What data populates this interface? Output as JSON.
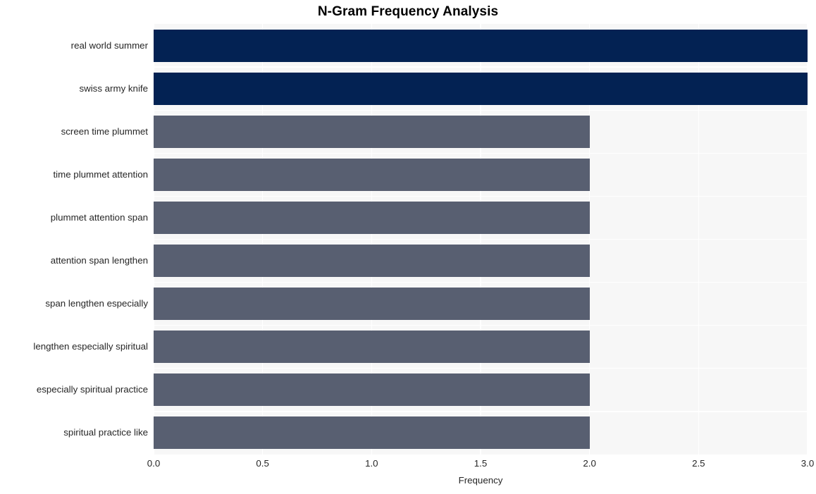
{
  "chart_data": {
    "type": "bar",
    "orientation": "horizontal",
    "title": "N-Gram Frequency Analysis",
    "xlabel": "Frequency",
    "ylabel": "",
    "categories": [
      "real world summer",
      "swiss army knife",
      "screen time plummet",
      "time plummet attention",
      "plummet attention span",
      "attention span lengthen",
      "span lengthen especially",
      "lengthen especially spiritual",
      "especially spiritual practice",
      "spiritual practice like"
    ],
    "values": [
      3,
      3,
      2,
      2,
      2,
      2,
      2,
      2,
      2,
      2
    ],
    "bar_colors": [
      "#032253",
      "#032253",
      "#585f71",
      "#585f71",
      "#585f71",
      "#585f71",
      "#585f71",
      "#585f71",
      "#585f71",
      "#585f71"
    ],
    "xlim": [
      0.0,
      3.0
    ],
    "xticks": [
      "0.0",
      "0.5",
      "1.0",
      "1.5",
      "2.0",
      "2.5",
      "3.0"
    ],
    "xtick_values": [
      0.0,
      0.5,
      1.0,
      1.5,
      2.0,
      2.5,
      3.0
    ],
    "grid": true,
    "grid_color": "#ffffff",
    "plot_background": "#f7f7f7",
    "figure_background": "#ffffff",
    "legend": null
  }
}
